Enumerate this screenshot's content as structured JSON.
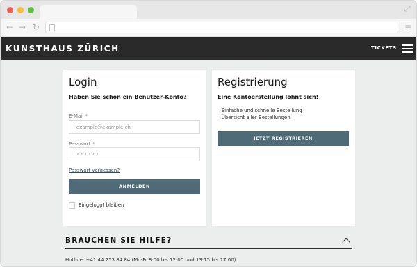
{
  "browser": {
    "icons": {
      "back": "arrow-left-icon",
      "forward": "arrow-right-icon",
      "reload": "reload-icon",
      "page": "page-icon",
      "menu": "menu-icon",
      "expand": "expand-icon"
    }
  },
  "header": {
    "logo": "KUNSTHAUS ZÜRICH",
    "tickets": "TICKETS"
  },
  "login": {
    "title": "Login",
    "subtitle": "Haben Sie schon ein Benutzer-Konto?",
    "email_label": "E-Mail *",
    "email_placeholder": "example@example.ch",
    "password_label": "Passwort *",
    "password_value": "••••••",
    "forgot": "Passwort vergessen?",
    "button": "ANMELDEN",
    "remember": "Eingeloggt bleiben"
  },
  "register": {
    "title": "Registrierung",
    "subtitle": "Eine Kontoerstellung lohnt sich!",
    "benefits": [
      "– Einfache und schnelle Bestellung",
      "– Übersicht aller Bestellungen"
    ],
    "button": "JETZT REGISTRIEREN"
  },
  "help": {
    "title": "BRAUCHEN SIE HILFE?",
    "hotline": "Hotline: +41 44 253 84 84 (Mo-Fr 8:00 bis 12:00 und 13:15 bis 17:00)"
  },
  "colors": {
    "header_bg": "#2a2a2a",
    "button_bg": "#4f6b78",
    "page_bg": "#eceeee"
  }
}
